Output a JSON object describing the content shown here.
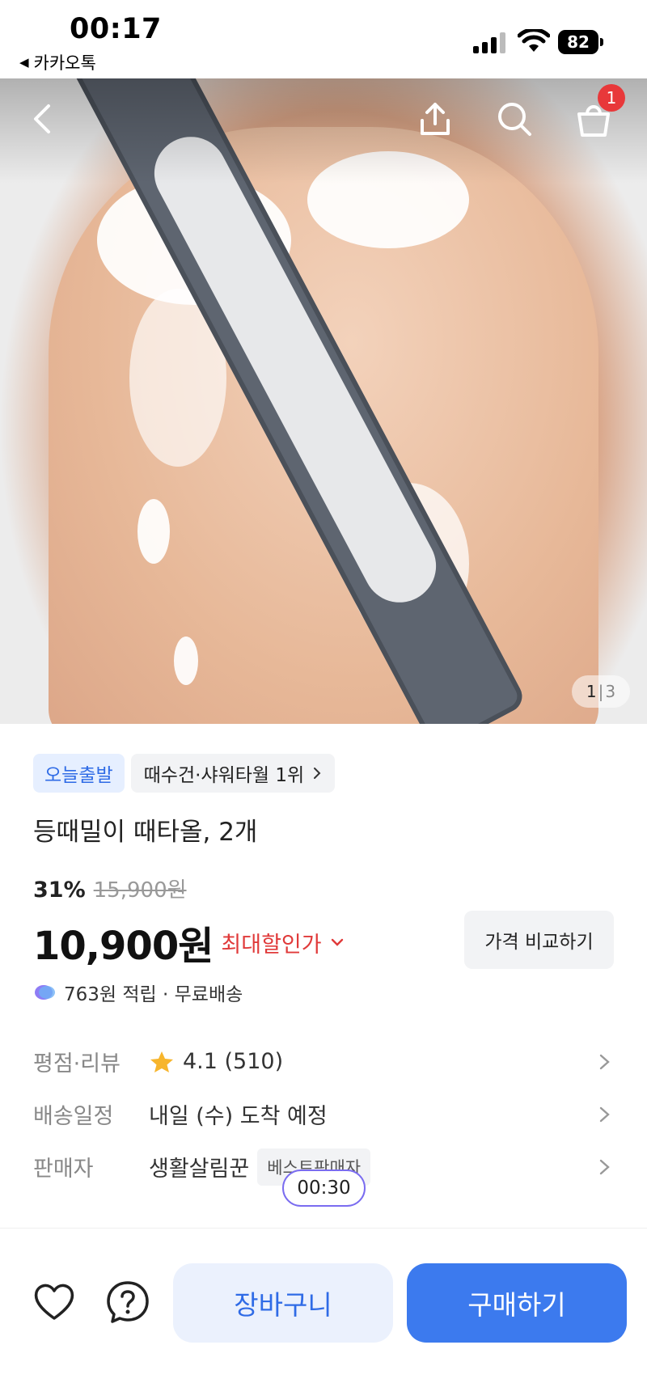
{
  "status_bar": {
    "time": "00:17",
    "back_app_label": "카카오톡",
    "battery": "82"
  },
  "hero": {
    "image_counter_current": "1",
    "image_counter_separator": "|",
    "image_counter_total": "3",
    "cart_badge_count": "1"
  },
  "product": {
    "tag_fast": "오늘출발",
    "tag_rank": "때수건·샤워타월 1위",
    "title": "등때밀이 때타올, 2개",
    "discount_percent": "31%",
    "original_price": "15,900원",
    "price": "10,900원",
    "max_discount_label": "최대할인가",
    "compare_button": "가격 비교하기",
    "points_text": "763원 적립 · 무료배송"
  },
  "info": {
    "rating_label": "평점·리뷰",
    "rating_value": "4.1 (510)",
    "delivery_label": "배송일정",
    "delivery_value": "내일 (수) 도착 예정",
    "seller_label": "판매자",
    "seller_value": "생활살림꾼",
    "seller_badge": "베스트판매자",
    "timer": "00:30"
  },
  "bottom_bar": {
    "cart_button": "장바구니",
    "buy_button": "구매하기"
  },
  "colors": {
    "accent_blue": "#3c7aee",
    "discount_red": "#e03a3a",
    "badge_red": "#e8383a",
    "star_yellow": "#f7b52c"
  }
}
